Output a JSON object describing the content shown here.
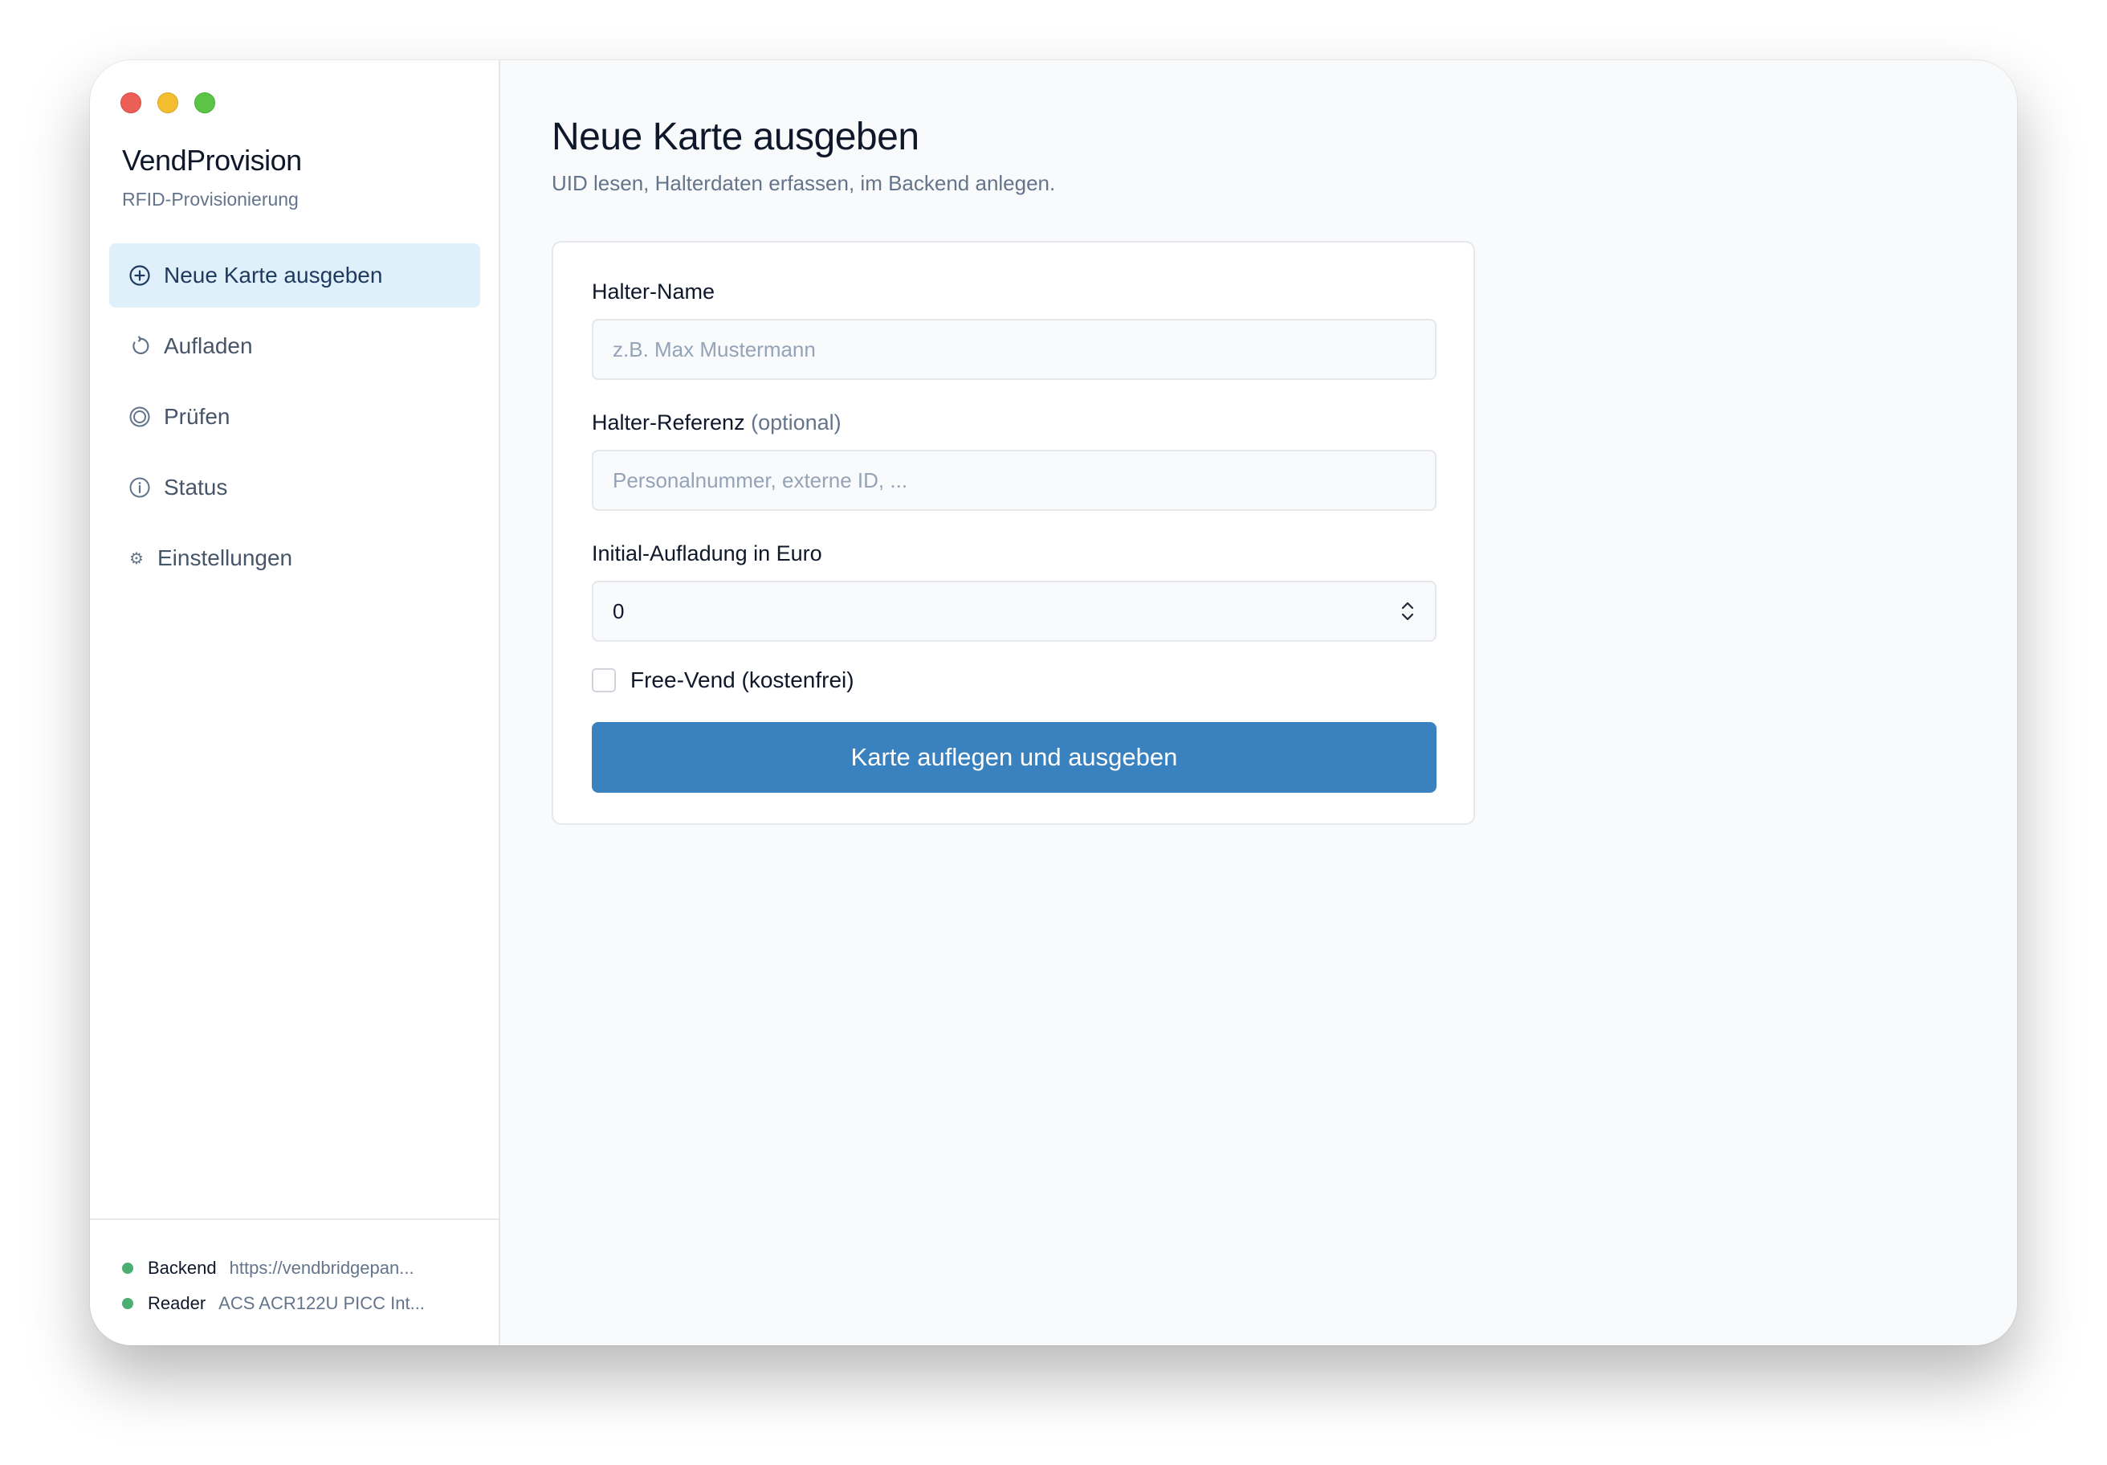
{
  "app": {
    "name": "VendProvision",
    "subtitle": "RFID-Provisionierung"
  },
  "sidebar": {
    "items": [
      {
        "label": "Neue Karte ausgeben",
        "icon": "plus-circle-icon",
        "active": true
      },
      {
        "label": "Aufladen",
        "icon": "refresh-icon",
        "active": false
      },
      {
        "label": "Prüfen",
        "icon": "radio-target-icon",
        "active": false
      },
      {
        "label": "Status",
        "icon": "info-circle-icon",
        "active": false
      },
      {
        "label": "Einstellungen",
        "icon": "gear-icon",
        "active": false
      }
    ],
    "status": [
      {
        "key": "Backend",
        "value": "https://vendbridgepan...",
        "color": "#4caf72"
      },
      {
        "key": "Reader",
        "value": "ACS ACR122U PICC Int...",
        "color": "#4caf72"
      }
    ]
  },
  "main": {
    "title": "Neue Karte ausgeben",
    "subtitle": "UID lesen, Halterdaten erfassen, im Backend anlegen.",
    "form": {
      "name_label": "Halter-Name",
      "name_placeholder": "z.B. Max Mustermann",
      "ref_label": "Halter-Referenz",
      "ref_optional": "(optional)",
      "ref_placeholder": "Personalnummer, externe ID, ...",
      "amount_label": "Initial-Aufladung in Euro",
      "amount_value": "0",
      "free_vend_label": "Free-Vend (kostenfrei)",
      "free_vend_checked": false,
      "submit_label": "Karte auflegen und ausgeben"
    }
  },
  "colors": {
    "accent": "#3a82bf",
    "active_nav_bg": "#dff0fb",
    "status_ok": "#4caf72"
  }
}
